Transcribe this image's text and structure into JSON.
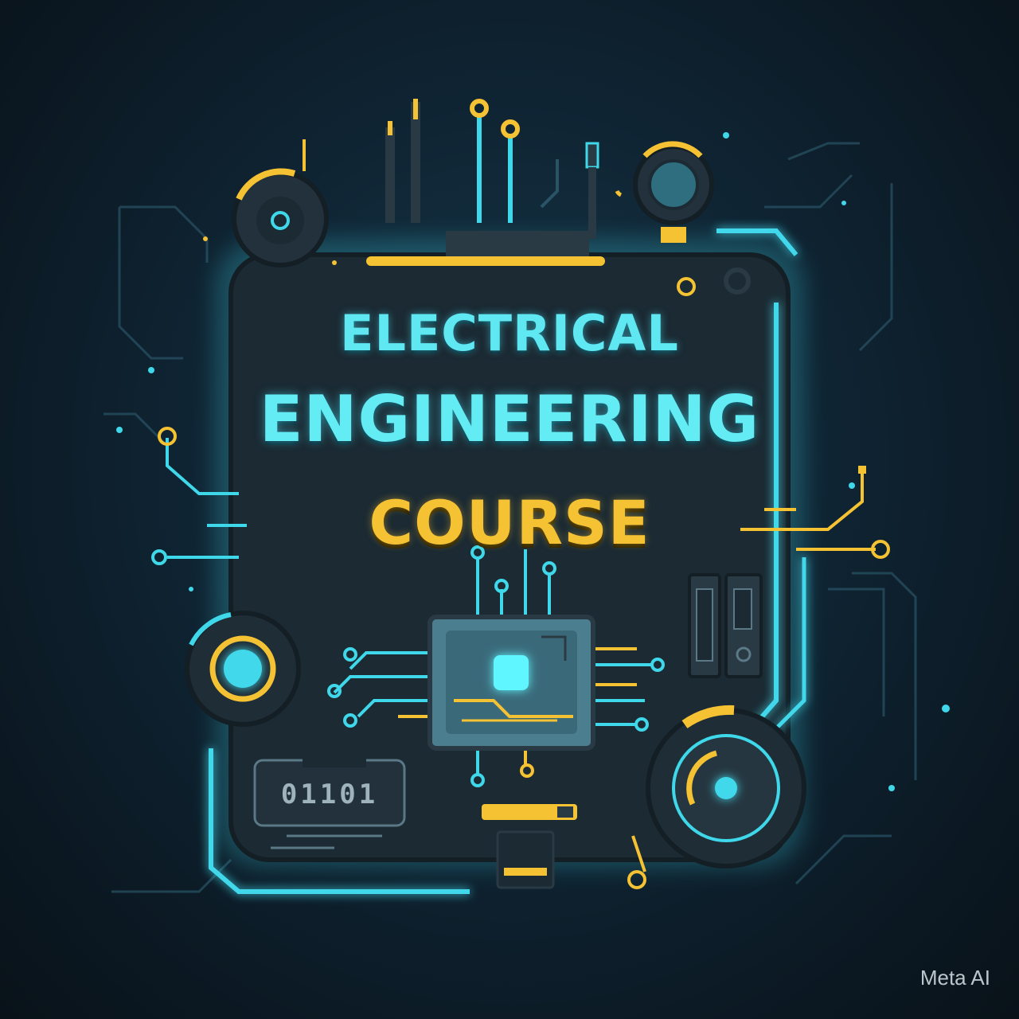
{
  "poster": {
    "title_line1": "ELECTRICAL",
    "title_line2": "ENGINEERING",
    "title_line3": "COURSE",
    "chip_label": "01101",
    "watermark": "Meta AI"
  },
  "colors": {
    "background": "#0f2433",
    "cyan": "#3fd8ea",
    "yellow": "#f5c233",
    "board": "#1b2a33"
  },
  "icons": [
    "circuit-board-icon",
    "microchip-icon",
    "gauge-icon",
    "switch-icon",
    "battery-icon"
  ]
}
